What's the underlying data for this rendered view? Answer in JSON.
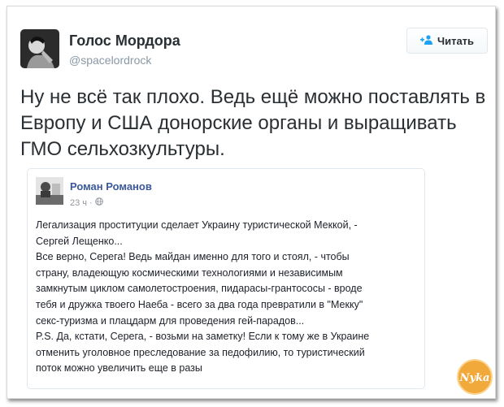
{
  "author": {
    "name": "Голос Мордора",
    "handle": "@spacelordrock"
  },
  "follow_button": {
    "label": "Читать",
    "icon": "add-user-icon"
  },
  "tweet": {
    "text": "Ну не всё так плохо. Ведь ещё можно поставлять в Европу и США донорские органы и выращивать ГМО сельхозкультуры."
  },
  "quoted_post": {
    "author_name": "Роман Романов",
    "time": "23 ч",
    "separator": "·",
    "privacy_icon": "globe-icon",
    "text": "Легализация проституции сделает Украину туристической Меккой, -\nСергей Лещенко...\nВсе верно, Серега! Ведь майдан именно для того и стоял, - чтобы\nстрану, владеющую космическими технологиями и независимым\nзамкнутым циклом самолетостроения, пидарасы-грантососы - вроде\nтебя и дружка твоего Наеба - всего за два года превратили в \"Мекку\"\nсекс-туризма и плацдарм для проведения гей-парадов...\nP.S. Да, кстати, Серега, - возьми на заметку! Если к тому же в Украине\nотменить уголовное преследование за педофилию, то туристический\nпоток можно увеличить еще в разы"
  },
  "watermark": {
    "text": "Nyka",
    "color": "#f0a030"
  }
}
